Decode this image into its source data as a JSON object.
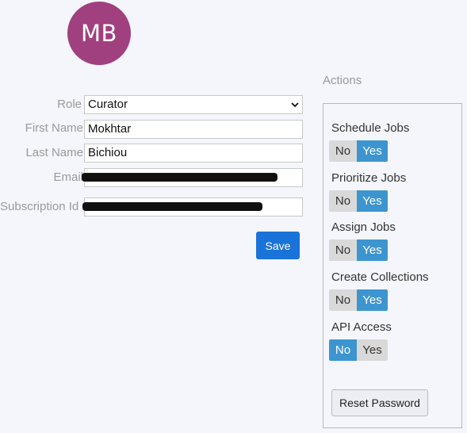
{
  "profile": {
    "initials": "MB"
  },
  "form": {
    "role_label": "Role",
    "role_value": "Curator",
    "first_name_label": "First Name",
    "first_name_value": "Mokhtar",
    "last_name_label": "Last Name",
    "last_name_value": "Bichiou",
    "email_label": "Email",
    "subscription_label": "Subscription Id",
    "save_label": "Save"
  },
  "actions": {
    "title": "Actions",
    "items": [
      {
        "label": "Schedule Jobs",
        "no": "No",
        "yes": "Yes",
        "selected": "Yes"
      },
      {
        "label": "Prioritize Jobs",
        "no": "No",
        "yes": "Yes",
        "selected": "Yes"
      },
      {
        "label": "Assign Jobs",
        "no": "No",
        "yes": "Yes",
        "selected": "Yes"
      },
      {
        "label": "Create Collections",
        "no": "No",
        "yes": "Yes",
        "selected": "Yes"
      },
      {
        "label": "API Access",
        "no": "No",
        "yes": "Yes",
        "selected": "No"
      }
    ],
    "reset_password_label": "Reset Password"
  },
  "colors": {
    "avatar": "#a0407e",
    "primary_button": "#1a73d8",
    "toggle_active": "#3d95d0",
    "toggle_inactive": "#d9d9d9"
  }
}
